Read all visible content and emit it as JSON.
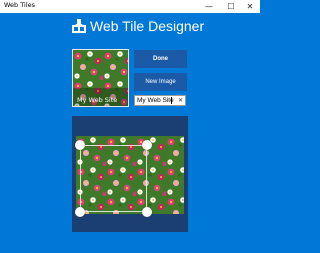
{
  "window": {
    "title": "Web Tiles",
    "minimize_glyph": "—",
    "maximize_glyph": "☐",
    "close_glyph": "✕"
  },
  "header": {
    "icon": "tile-designer-icon",
    "title": "Web Tile Designer"
  },
  "preview": {
    "caption": "My Web Site"
  },
  "buttons": {
    "done": "Done",
    "new_image": "New Image"
  },
  "name_input": {
    "value": "My Web Site",
    "clear_glyph": "✕"
  },
  "colors": {
    "accent": "#0078d7",
    "button": "#1a5aa6",
    "editor_bg": "#1b3f73"
  }
}
